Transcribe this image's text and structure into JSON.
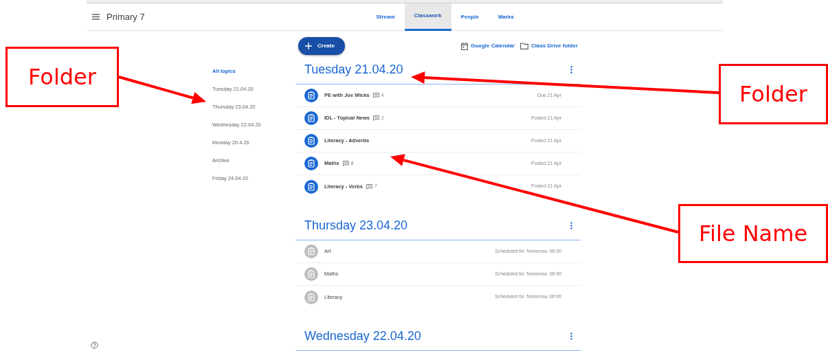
{
  "header": {
    "class_name": "Primary 7",
    "tabs": [
      {
        "label": "Stream",
        "selected": false
      },
      {
        "label": "Classwork",
        "selected": true
      },
      {
        "label": "People",
        "selected": false
      },
      {
        "label": "Marks",
        "selected": false
      }
    ]
  },
  "toolbar": {
    "create": "Create",
    "links": [
      {
        "kind": "calendar",
        "label": "Google Calendar"
      },
      {
        "kind": "folder",
        "label": "Class Drive folder"
      }
    ]
  },
  "topics": [
    {
      "label": "All topics",
      "selected": true
    },
    {
      "label": "Tuesday 21.04.20",
      "selected": false
    },
    {
      "label": "Thursday 23.04.20",
      "selected": false
    },
    {
      "label": "Wednesday 22.04.20",
      "selected": false
    },
    {
      "label": "Monday 20.4.20",
      "selected": false
    },
    {
      "label": "Archive",
      "selected": false
    },
    {
      "label": "Friday 24.04.20",
      "selected": false
    }
  ],
  "sections": [
    {
      "title": "Tuesday 21.04.20",
      "items": [
        {
          "title": "PE with Joe Wicks",
          "comments": "4",
          "date": "Due 21 Apr",
          "kind": "posted"
        },
        {
          "title": "IDL - Topical News",
          "comments": "2",
          "date": "Posted 21 Apr",
          "kind": "posted"
        },
        {
          "title": "Literacy - Adverbs",
          "date": "Posted 21 Apr",
          "kind": "posted"
        },
        {
          "title": "Maths",
          "comments": "8",
          "date": "Posted 21 Apr",
          "kind": "posted"
        },
        {
          "title": "Literacy - Verbs",
          "comments": "7",
          "date": "Posted 21 Apr",
          "kind": "posted"
        }
      ]
    },
    {
      "title": "Thursday 23.04.20",
      "items": [
        {
          "title": "Art",
          "date": "Scheduled for Tomorrow, 08:00",
          "kind": "scheduled"
        },
        {
          "title": "Maths",
          "date": "Scheduled for Tomorrow, 08:00",
          "kind": "scheduled"
        },
        {
          "title": "Literacy",
          "date": "Scheduled for Tomorrow, 08:00",
          "kind": "scheduled"
        }
      ]
    },
    {
      "title": "Wednesday 22.04.20"
    }
  ],
  "callouts": [
    {
      "label": "Folder"
    },
    {
      "label": "Folder"
    },
    {
      "label": "File Name"
    }
  ]
}
